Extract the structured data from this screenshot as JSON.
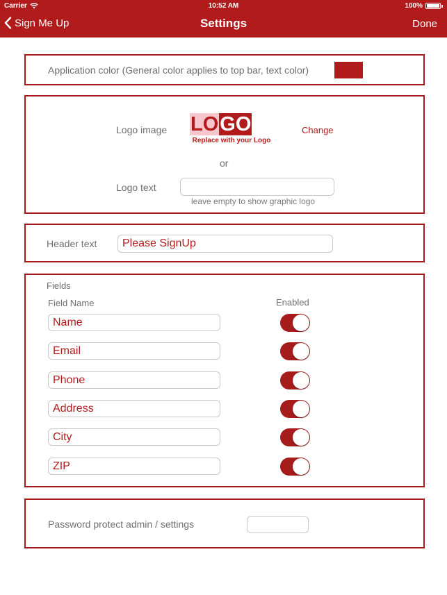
{
  "status_bar": {
    "carrier": "Carrier",
    "time": "10:52 AM",
    "battery": "100%"
  },
  "nav": {
    "back_label": "Sign Me Up",
    "title": "Settings",
    "done_label": "Done"
  },
  "app_color": {
    "label": "Application color (General color applies to top bar, text color)",
    "color": "#b21b1b"
  },
  "logo": {
    "image_label": "Logo image",
    "logo_text_lo": "LO",
    "logo_text_go": "GO",
    "logo_tagline": "Replace with your Logo",
    "change_label": "Change",
    "or_label": "or",
    "text_label": "Logo text",
    "text_value": "",
    "hint": "leave empty to show graphic logo"
  },
  "header": {
    "label": "Header text",
    "value": "Please SignUp"
  },
  "fields": {
    "section_title": "Fields",
    "col_name": "Field Name",
    "col_enabled": "Enabled",
    "items": [
      {
        "name": "Name",
        "enabled": true
      },
      {
        "name": "Email",
        "enabled": true
      },
      {
        "name": "Phone",
        "enabled": true
      },
      {
        "name": "Address",
        "enabled": true
      },
      {
        "name": "City",
        "enabled": true
      },
      {
        "name": "ZIP",
        "enabled": true
      }
    ]
  },
  "password": {
    "label": "Password protect admin / settings",
    "value": ""
  },
  "colors": {
    "accent": "#b21b1b",
    "border": "#a61c1c",
    "logo_light": "#f7c6cc"
  }
}
